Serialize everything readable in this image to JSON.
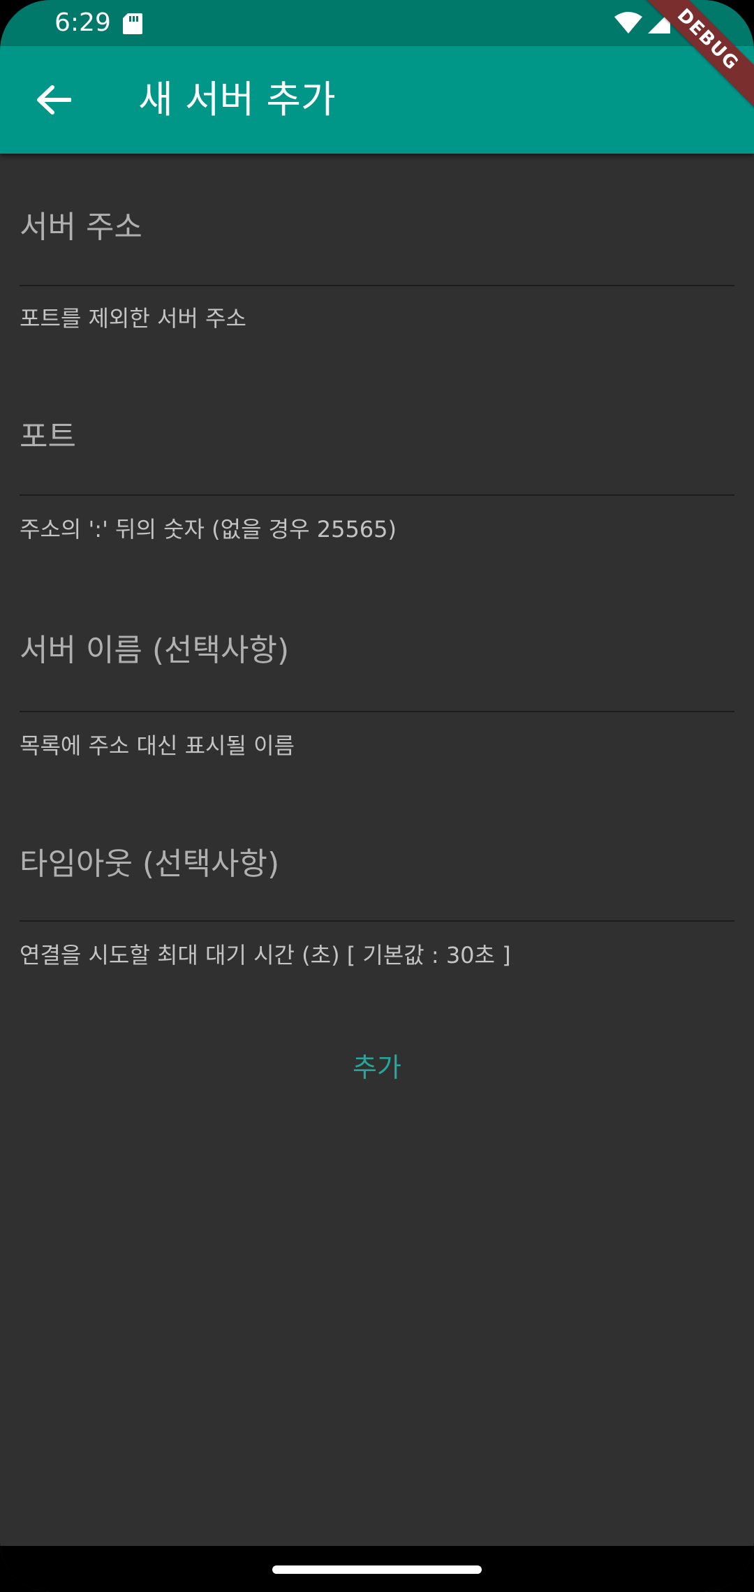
{
  "status_bar": {
    "time": "6:29",
    "icons": [
      "sd-card-icon",
      "wifi-icon",
      "cell-signal-icon",
      "battery-icon"
    ]
  },
  "app_bar": {
    "title": "새 서버 추가",
    "back_icon": "arrow-back-icon",
    "background": "#009688"
  },
  "debug_banner": "DEBUG",
  "form": {
    "fields": [
      {
        "label": "서버 주소",
        "helper": "포트를 제외한 서버 주소"
      },
      {
        "label": "포트",
        "helper": "주소의 ':' 뒤의 숫자 (없을 경우 25565)"
      },
      {
        "label": "서버 이름 (선택사항)",
        "helper": "목록에 주소 대신 표시될 이름"
      },
      {
        "label": "타임아웃 (선택사항)",
        "helper": "연결을 시도할 최대 대기 시간 (초) [ 기본값 : 30초 ]"
      }
    ],
    "submit_label": "추가"
  },
  "colors": {
    "status_bar": "#00796b",
    "app_bar": "#009688",
    "background": "#303030",
    "accent": "#26a69a",
    "debug": "#7a2e2e"
  }
}
